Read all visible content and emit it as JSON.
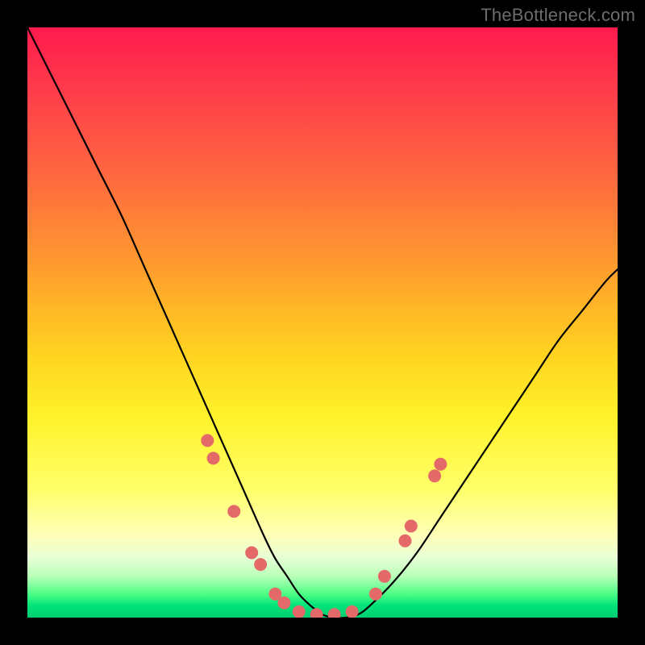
{
  "watermark": "TheBottleneck.com",
  "colors": {
    "frame": "#000000",
    "curve": "#000000",
    "marker_fill": "#e46a6a",
    "marker_stroke": "#c94f4f",
    "gradient_top": "#ff1a4d",
    "gradient_bottom": "#00cf72"
  },
  "chart_data": {
    "type": "line",
    "title": "",
    "xlabel": "",
    "ylabel": "",
    "xlim": [
      0,
      100
    ],
    "ylim": [
      0,
      100
    ],
    "grid": false,
    "legend": false,
    "series": [
      {
        "name": "bottleneck-curve",
        "x": [
          0,
          4,
          8,
          12,
          16,
          20,
          24,
          28,
          32,
          36,
          40,
          42,
          44,
          46,
          48,
          50,
          52,
          54,
          56,
          58,
          62,
          66,
          70,
          74,
          78,
          82,
          86,
          90,
          94,
          98,
          100
        ],
        "y": [
          100,
          92,
          84,
          76,
          68,
          59,
          50,
          41,
          32,
          23,
          14,
          10,
          7,
          4,
          2,
          0.5,
          0,
          0,
          0.5,
          2,
          6,
          11,
          17,
          23,
          29,
          35,
          41,
          47,
          52,
          57,
          59
        ]
      }
    ],
    "markers": [
      {
        "x": 30.5,
        "y": 30
      },
      {
        "x": 31.5,
        "y": 27
      },
      {
        "x": 35,
        "y": 18
      },
      {
        "x": 38,
        "y": 11
      },
      {
        "x": 39.5,
        "y": 9
      },
      {
        "x": 42,
        "y": 4
      },
      {
        "x": 43.5,
        "y": 2.5
      },
      {
        "x": 46,
        "y": 1
      },
      {
        "x": 49,
        "y": 0.5
      },
      {
        "x": 52,
        "y": 0.5
      },
      {
        "x": 55,
        "y": 1
      },
      {
        "x": 59,
        "y": 4
      },
      {
        "x": 60.5,
        "y": 7
      },
      {
        "x": 64,
        "y": 13
      },
      {
        "x": 65,
        "y": 15.5
      },
      {
        "x": 69,
        "y": 24
      },
      {
        "x": 70,
        "y": 26
      }
    ]
  }
}
